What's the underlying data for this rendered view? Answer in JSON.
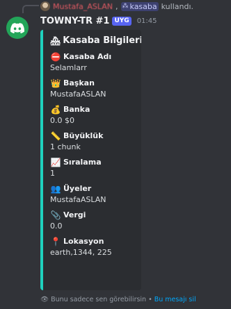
{
  "reply": {
    "user": "Mustafa_ASLAN",
    "separator": ",",
    "command": "kasaba",
    "suffix": "kullandı."
  },
  "message": {
    "username": "TOWNY-TR #1",
    "badge": "UYG",
    "timestamp": "01:45"
  },
  "embed": {
    "accent_color": "#1fd1bd",
    "title_icon": "houses-icon",
    "title": "Kasaba Bilgileri",
    "fields": [
      {
        "icon": "no-entry-icon",
        "name": "Kasaba Adı",
        "value": "Selamlarr"
      },
      {
        "icon": "crown-icon",
        "name": "Başkan",
        "value": "MustafaASLAN"
      },
      {
        "icon": "money-bag-icon",
        "name": "Banka",
        "value": "0.0 $0"
      },
      {
        "icon": "ruler-icon",
        "name": "Büyüklük",
        "value": "1 chunk"
      },
      {
        "icon": "chart-increasing-icon",
        "name": "Sıralama",
        "value": "1"
      },
      {
        "icon": "people-icon",
        "name": "Üyeler",
        "value": "MustafaASLAN"
      },
      {
        "icon": "paperclip-icon",
        "name": "Vergi",
        "value": "0.0"
      },
      {
        "icon": "pin-icon",
        "name": "Lokasyon",
        "value": "earth,1344, 225"
      }
    ]
  },
  "footer": {
    "text": "Bunu sadece sen görebilirsin",
    "separator": "•",
    "link": "Bu mesajı sil"
  }
}
